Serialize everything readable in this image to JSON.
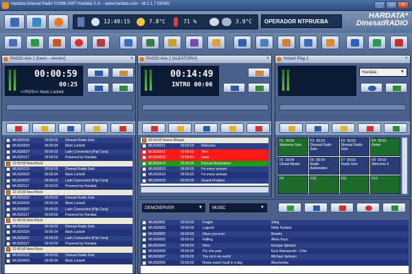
{
  "window": {
    "title": "Hardata Dinesat Radio ©1996-2007 Hardata S.A. - www.hardata.com - v8.1.1.7 DEMO",
    "min_label": "_",
    "max_label": "□",
    "close_label": "×"
  },
  "status": {
    "clock": "12:49:15",
    "temp1": "7.8°C",
    "humidity": "71 %",
    "temp2": "3.9°C",
    "operator": "OPERADOR NTPRUEBA"
  },
  "logo": {
    "line1": "HARDATA*",
    "line2": "DinesatRADIO"
  },
  "topbar_icons": [
    "playlist-icon",
    "grid-icon",
    "cd-icon",
    "clock-icon",
    "weather-icon",
    "thermometer-icon",
    "humidity-icon",
    "cloud-icon"
  ],
  "toolbar2_icons": [
    "search-icon",
    "play-icon",
    "tools-icon",
    "record-icon",
    "pen-icon",
    "schedule-icon",
    "list-icon",
    "clipboard-icon",
    "mic-icon",
    "user-icon",
    "calendar-icon",
    "database-icon",
    "shop-icon",
    "folder-icon",
    "monitor-icon",
    "users-icon",
    "plus-icon",
    "phone-icon",
    "exit-icon"
  ],
  "panel1": {
    "title": "RADIO Aire 1 [lunes - viernes]",
    "time_main": "00:00:59",
    "time_sub": "00:25",
    "rds": "<<RDS>> Mark Lockett",
    "rows": [
      {
        "t": "n",
        "id": "MUS00119",
        "tm": "00:00:03",
        "title": "Dinesat Radio Solo"
      },
      {
        "t": "a",
        "id": "MUS00029",
        "tm": "00:00:34",
        "title": "Mark Lockett"
      },
      {
        "t": "n",
        "id": "MUS00037",
        "tm": "00:00:03",
        "title": "Latin Connection [Pipi Cora]"
      },
      {
        "t": "a",
        "id": "MUS00117",
        "tm": "00:00:03",
        "title": "Powered by Hardata"
      },
      {
        "t": "h",
        "id": "12:00:00 New Block",
        "tm": "",
        "title": ""
      },
      {
        "t": "n",
        "id": "MUS00119",
        "tm": "00:00:03",
        "title": "Dinesat Radio Solo"
      },
      {
        "t": "a",
        "id": "MUS00029",
        "tm": "00:00:34",
        "title": "Mark Lockett"
      },
      {
        "t": "n",
        "id": "MUS00037",
        "tm": "00:00:03",
        "title": "Latin Connection [Pipi Cora]"
      },
      {
        "t": "a",
        "id": "MUS00117",
        "tm": "00:00:03",
        "title": "Powered by Hardata"
      },
      {
        "t": "h",
        "id": "12:15:00 New Block",
        "tm": "",
        "title": ""
      },
      {
        "t": "n",
        "id": "MUS00119",
        "tm": "00:00:03",
        "title": "Dinesat Radio Solo"
      },
      {
        "t": "a",
        "id": "MUS00029",
        "tm": "00:00:34",
        "title": "Mark Lockett"
      },
      {
        "t": "n",
        "id": "MUS00037",
        "tm": "00:00:03",
        "title": "Latin Connection [Pipi Cora]"
      },
      {
        "t": "a",
        "id": "MUS00117",
        "tm": "00:00:03",
        "title": "Powered by Hardata"
      },
      {
        "t": "h",
        "id": "12:30:00 New Block",
        "tm": "",
        "title": ""
      },
      {
        "t": "n",
        "id": "MUS00119",
        "tm": "00:00:03",
        "title": "Dinesat Radio Solo"
      },
      {
        "t": "a",
        "id": "MUS00029",
        "tm": "00:00:34",
        "title": "Mark Lockett"
      },
      {
        "t": "n",
        "id": "MUS00037",
        "tm": "00:00:03",
        "title": "Latin Connection [Pipi Cora]"
      },
      {
        "t": "a",
        "id": "MUS00117",
        "tm": "00:00:03",
        "title": "Powered by Hardata"
      },
      {
        "t": "h",
        "id": "12:45:00 New Block",
        "tm": "",
        "title": ""
      },
      {
        "t": "n",
        "id": "MUS00119",
        "tm": "00:00:03",
        "title": "Dinesat Radio Solo"
      },
      {
        "t": "a",
        "id": "MUS00029",
        "tm": "00:00:34",
        "title": "Mark Lockett"
      }
    ]
  },
  "panel2": {
    "title": "RADIO Aire 2 [ALEATORIA]",
    "time_main": "00:14:49",
    "time_sub": "INTRO 00:06",
    "rows": [
      {
        "t": "h",
        "id": "00:00:00 Nuevo Bloque",
        "tm": "",
        "title": ""
      },
      {
        "t": "n",
        "id": "MUS00011",
        "tm": "00:00:03",
        "title": "Welcome"
      },
      {
        "t": "r",
        "id": "MUS00012",
        "tm": "00:00:03",
        "title": "Torn"
      },
      {
        "t": "r",
        "id": "MUS00013",
        "tm": "00:00:03",
        "title": "Jaws"
      },
      {
        "t": "g",
        "id": "MUS00014",
        "tm": "00:00:03",
        "title": "Dinesat Automation"
      },
      {
        "t": "n",
        "id": "MUS00015",
        "tm": "00:00:03",
        "title": "I'm every woman"
      },
      {
        "t": "a",
        "id": "MUS00016",
        "tm": "00:00:03",
        "title": "I'm every woman"
      },
      {
        "t": "n",
        "id": "MUS00010",
        "tm": "00:00:03",
        "title": "Sound Problem"
      }
    ]
  },
  "panel3": {
    "title": "Instant Play 1",
    "select": "Hardata",
    "cells": [
      {
        "k": "F1",
        "tm": "00:03",
        "name": "Welcome Solo"
      },
      {
        "k": "F2",
        "tm": "00:03",
        "name": "Dinesat Radio Solo"
      },
      {
        "k": "F3",
        "tm": "00:02",
        "name": "Dinesat Radio Solo"
      },
      {
        "k": "F4",
        "tm": "00:01",
        "name": "Rebel"
      },
      {
        "k": "F5",
        "tm": "00:04",
        "name": "Global Media"
      },
      {
        "k": "F6",
        "tm": "00:04",
        "name": "Radio Automation"
      },
      {
        "k": "F7",
        "tm": "00:05",
        "name": "Radio Solo"
      },
      {
        "k": "F8",
        "tm": "00:03",
        "name": "Welcome 4"
      },
      {
        "k": "F9",
        "tm": "",
        "name": ""
      },
      {
        "k": "F10",
        "tm": "",
        "name": ""
      },
      {
        "k": "F11",
        "tm": "",
        "name": ""
      },
      {
        "k": "F12",
        "tm": "",
        "name": ""
      }
    ]
  },
  "browser": {
    "server": "DEMOSERVER",
    "category": "MUSIC",
    "rows": [
      {
        "t": "n",
        "id": "MUS00001",
        "tm": "00:00:03",
        "title": "Fragile",
        "artist": "Sting"
      },
      {
        "t": "a",
        "id": "MUS00003",
        "tm": "00:00:03",
        "title": "Legend",
        "artist": "Nelly Furtado"
      },
      {
        "t": "n",
        "id": "MUS00002",
        "tm": "00:00:03",
        "title": "Have you ever",
        "artist": "Brandy"
      },
      {
        "t": "a",
        "id": "MUS00005",
        "tm": "00:00:03",
        "title": "Falling",
        "artist": "Alicia Keys"
      },
      {
        "t": "n",
        "id": "MUS00004",
        "tm": "00:00:03",
        "title": "Hero",
        "artist": "Enrique Iglesias"
      },
      {
        "t": "a",
        "id": "MUS00008",
        "tm": "00:00:03",
        "title": "Pio che puoi",
        "artist": "Eros Ramazzotti - Cher"
      },
      {
        "t": "n",
        "id": "MUS00007",
        "tm": "00:00:03",
        "title": "You rock my world",
        "artist": "Michael Jackson"
      },
      {
        "t": "a",
        "id": "MUS00006",
        "tm": "00:00:03",
        "title": "Rome wasn't built in a day",
        "artist": "Morcheeba"
      }
    ]
  }
}
